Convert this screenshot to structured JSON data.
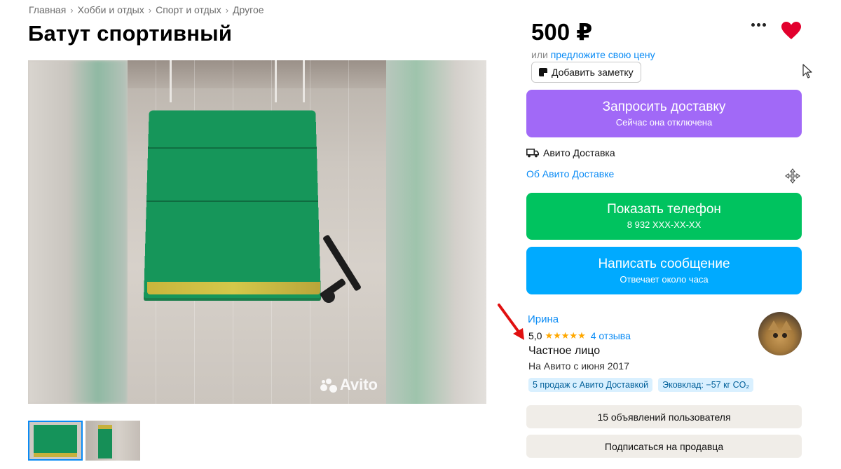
{
  "breadcrumb": [
    "Главная",
    "Хобби и отдых",
    "Спорт и отдых",
    "Другое"
  ],
  "breadcrumb_separator": "›",
  "title": "Батут спортивный",
  "gallery": {
    "watermark": "Avito",
    "thumbnail_count": 2
  },
  "price": "500 ₽",
  "offer": {
    "prefix": "или",
    "link": "предложите свою цену"
  },
  "note_button": "Добавить заметку",
  "delivery_button": {
    "label": "Запросить доставку",
    "sub": "Сейчас она отключена",
    "color": "#a169f7"
  },
  "avito_delivery_label": "Авито Доставка",
  "about_delivery_link": "Об Авито Доставке",
  "phone_button": {
    "label": "Показать телефон",
    "sub": "8 932 XXX-XX-XX",
    "color": "#00c35f"
  },
  "message_button": {
    "label": "Написать сообщение",
    "sub": "Отвечает около часа",
    "color": "#00aaff"
  },
  "seller": {
    "name": "Ирина",
    "rating": "5,0",
    "stars": "★★★★★",
    "reviews": "4 отзыва",
    "type": "Частное лицо",
    "since": "На Авито с июня 2017",
    "badges": [
      "5 продаж с Авито Доставкой",
      "Эковклад: −57 кг CO₂"
    ]
  },
  "user_ads_button": "15 объявлений пользователя",
  "subscribe_button": "Подписаться на продавца",
  "colors": {
    "link": "#0a8bf5",
    "heart": "#e2002d",
    "secondary_bg": "#f0ede8",
    "badge_bg": "#d9f0ff",
    "annotation_arrow": "#e01010"
  }
}
